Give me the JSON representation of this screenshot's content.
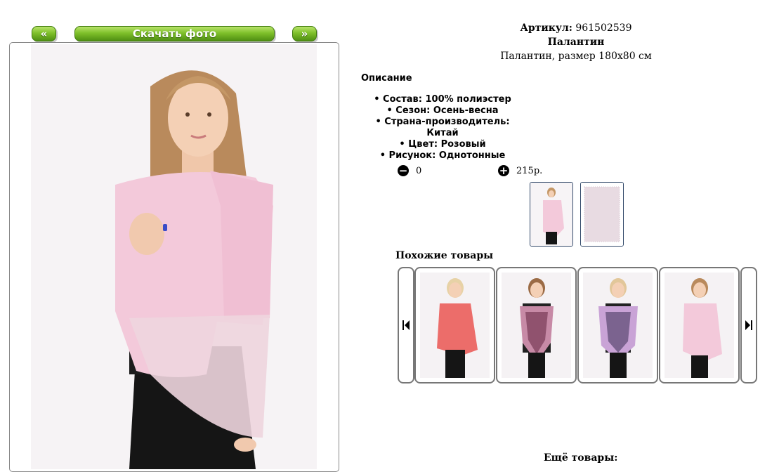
{
  "nav": {
    "prev_label": "«",
    "download_label": "Скачать фото",
    "next_label": "»"
  },
  "product": {
    "article_label": "Артикул:",
    "article_value": "961502539",
    "name": "Палантин",
    "subtitle": "Палантин, размер 180х80 см"
  },
  "description": {
    "heading": "Описание",
    "items": [
      "Состав: 100% полиэстер",
      "Сезон: Осень-весна",
      "Страна-производитель: Китай",
      "Цвет: Розовый",
      "Рисунок: Однотонные"
    ]
  },
  "purchase": {
    "quantity": "0",
    "price": "215р."
  },
  "similar": {
    "title": "Похожие товары"
  },
  "more": {
    "title": "Ещё товары:"
  },
  "colors": {
    "button_green": "#6fb021",
    "scarf_pink": "#f2c7d8",
    "coral": "#ec6d6a",
    "lilac": "#c9a3d6",
    "frame_border": "#888888",
    "thumb_border": "#334a6a"
  },
  "icons": {
    "minus": "minus-circle-icon",
    "plus": "plus-circle-icon",
    "prev": "skip-prev-icon",
    "next": "skip-next-icon"
  }
}
